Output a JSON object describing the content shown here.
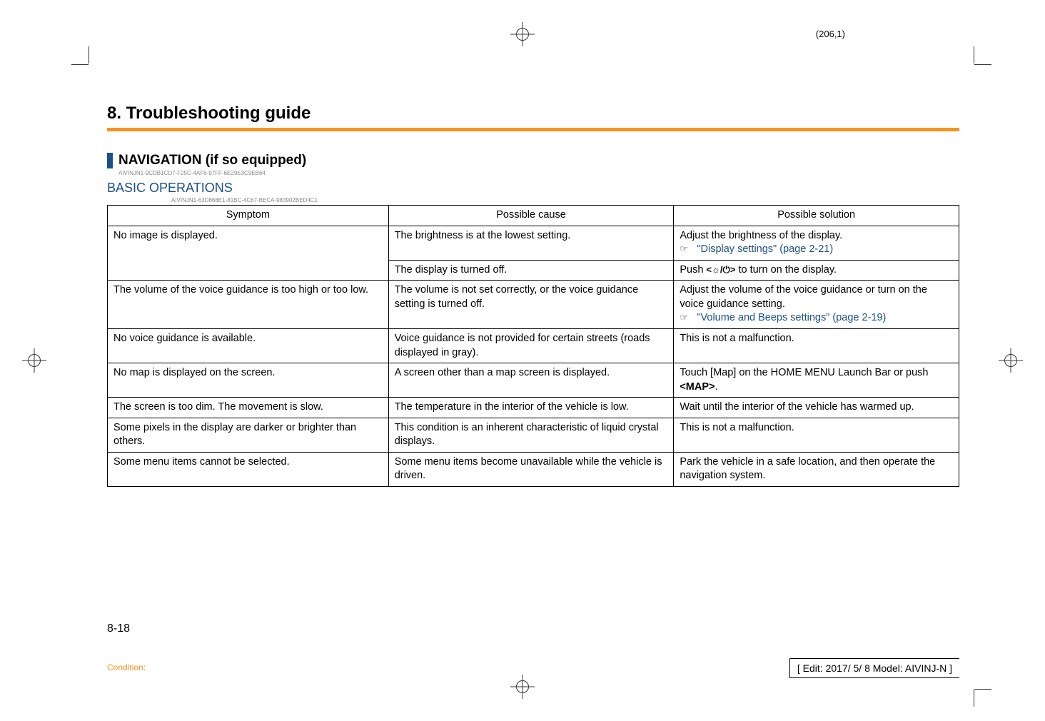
{
  "page_coord": "(206,1)",
  "chapter_title": "8. Troubleshooting guide",
  "section_title": "NAVIGATION (if so equipped)",
  "section_id": "AIVINJN1-9CDB1CD7-F25C-4AF6-97FF-6E29E3C9EB64",
  "sub_title": "BASIC OPERATIONS",
  "sub_id": "AIVINJN1-63D868E1-81BC-4C67-BECA-983902BED4C1",
  "headers": {
    "c1": "Symptom",
    "c2": "Possible cause",
    "c3": "Possible solution"
  },
  "rows": [
    {
      "symptom": "No image is displayed.",
      "cause": "The brightness is at the lowest setting.",
      "solution_lines": [
        "Adjust the brightness of the display."
      ],
      "link": "\"Display settings\" (page 2-21)"
    },
    {
      "symptom": "",
      "cause": "The display is turned off.",
      "solution_pre": "Push ",
      "solution_icon": "<☼/⏻>",
      "solution_post": " to turn on the display."
    },
    {
      "symptom": "The volume of the voice guidance is too high or too low.",
      "cause": "The volume is not set correctly, or the voice guidance setting is turned off.",
      "solution_lines": [
        "Adjust the volume of the voice guidance or turn on the voice guidance setting."
      ],
      "link": "\"Volume and Beeps settings\" (page 2-19)"
    },
    {
      "symptom": "No voice guidance is available.",
      "cause": "Voice guidance is not provided for certain streets (roads displayed in gray).",
      "solution": "This is not a malfunction."
    },
    {
      "symptom": "No map is displayed on the screen.",
      "cause": "A screen other than a map screen is displayed.",
      "solution_pre": "Touch [Map] on the HOME MENU Launch Bar or push ",
      "solution_bold": "<MAP>",
      "solution_post": "."
    },
    {
      "symptom": "The screen is too dim. The movement is slow.",
      "cause": "The temperature in the interior of the vehicle is low.",
      "solution": "Wait until the interior of the vehicle has warmed up."
    },
    {
      "symptom": "Some pixels in the display are darker or brighter than others.",
      "cause": "This condition is an inherent characteristic of liquid crystal displays.",
      "solution": "This is not a malfunction."
    },
    {
      "symptom": "Some menu items cannot be selected.",
      "cause": "Some menu items become unavailable while the vehicle is driven.",
      "solution": "Park the vehicle in a safe location, and then operate the navigation system."
    }
  ],
  "page_num": "8-18",
  "condition_label": "Condition:",
  "edit_box": "[ Edit: 2017/ 5/ 8   Model:  AIVINJ-N ]",
  "hand_glyph": "☞"
}
